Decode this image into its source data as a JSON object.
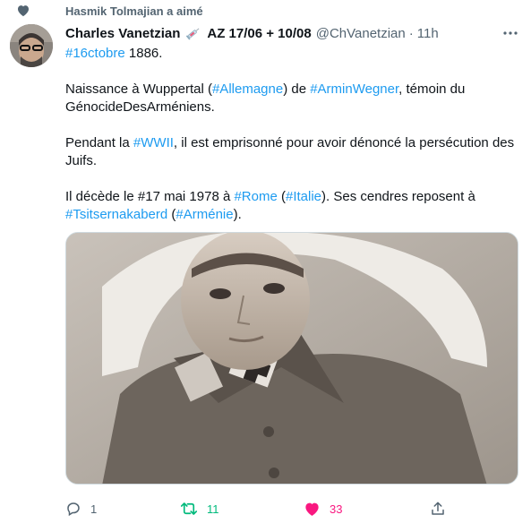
{
  "social_context": {
    "icon": "heart-icon",
    "text": "Hasmik Tolmajian a aimé"
  },
  "tweet": {
    "author_name": "Charles Vanetzian",
    "name_emoji": "syringe-emoji",
    "name_suffix": "AZ 17/06 + 10/08",
    "handle": "@ChVanetzian",
    "separator": "·",
    "time": "11h",
    "more_icon": "more-icon",
    "paragraphs": [
      [
        {
          "t": "#16ctobre",
          "tag": true
        },
        {
          "t": " 1886."
        }
      ],
      [
        {
          "t": "Naissance à Wuppertal ("
        },
        {
          "t": "#Allemagne",
          "tag": true
        },
        {
          "t": ") de "
        },
        {
          "t": "#ArminWegner",
          "tag": true
        },
        {
          "t": ", témoin du GénocideDesArméniens."
        }
      ],
      [
        {
          "t": "Pendant la "
        },
        {
          "t": "#WWII",
          "tag": true
        },
        {
          "t": ", il est emprisonné pour avoir dénoncé la persécution des Juifs."
        }
      ],
      [
        {
          "t": "Il décède le #17 mai 1978 à "
        },
        {
          "t": "#Rome",
          "tag": true
        },
        {
          "t": " ("
        },
        {
          "t": "#Italie",
          "tag": true
        },
        {
          "t": "). Ses cendres reposent à "
        },
        {
          "t": "#Tsitsernakaberd",
          "tag": true
        },
        {
          "t": " ("
        },
        {
          "t": "#Arménie",
          "tag": true
        },
        {
          "t": ")."
        }
      ]
    ],
    "actions": {
      "reply": {
        "icon": "reply-icon",
        "count": "1"
      },
      "retweet": {
        "icon": "retweet-icon",
        "count": "11",
        "color": "#00ba7c"
      },
      "like": {
        "icon": "heart-filled-icon",
        "count": "33",
        "color": "#f91880"
      },
      "share": {
        "icon": "share-icon"
      }
    }
  },
  "colors": {
    "link": "#1d9bf0",
    "secondary_text": "#536471"
  }
}
